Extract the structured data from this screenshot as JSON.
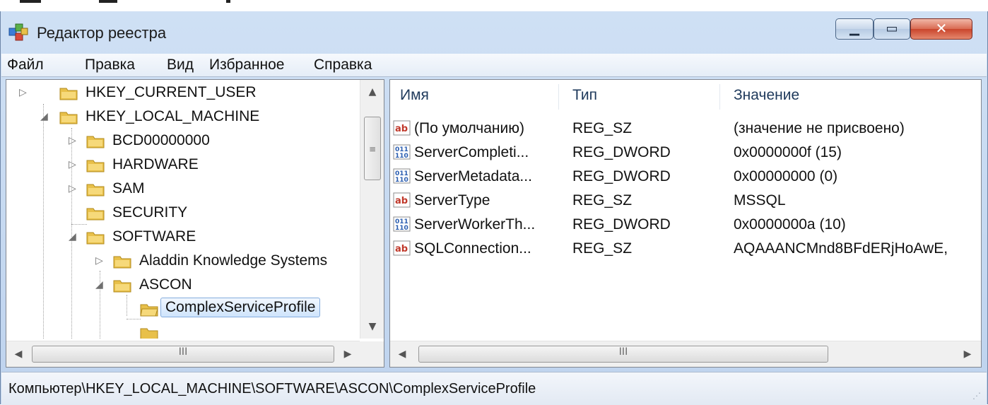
{
  "window": {
    "title": "Редактор реестра",
    "controls": {
      "minimize_icon": "minimize-icon",
      "maximize_icon": "maximize-icon",
      "close_icon": "close-icon"
    }
  },
  "menu": [
    "Файл",
    "Правка",
    "Вид",
    "Избранное",
    "Справка"
  ],
  "tree": {
    "items": [
      {
        "label": "HKEY_CURRENT_USER",
        "expanded": false,
        "level": 0
      },
      {
        "label": "HKEY_LOCAL_MACHINE",
        "expanded": true,
        "level": 0
      },
      {
        "label": "BCD00000000",
        "expanded": false,
        "level": 1
      },
      {
        "label": "HARDWARE",
        "expanded": false,
        "level": 1
      },
      {
        "label": "SAM",
        "expanded": false,
        "level": 1
      },
      {
        "label": "SECURITY",
        "expanded": null,
        "level": 1
      },
      {
        "label": "SOFTWARE",
        "expanded": true,
        "level": 1
      },
      {
        "label": "Aladdin Knowledge Systems",
        "expanded": false,
        "level": 2
      },
      {
        "label": "ASCON",
        "expanded": true,
        "level": 2
      },
      {
        "label": "ComplexServiceProfile",
        "expanded": null,
        "level": 3,
        "selected": true
      }
    ]
  },
  "list": {
    "columns": [
      "Имя",
      "Тип",
      "Значение"
    ],
    "rows": [
      {
        "icon": "string-value-icon",
        "name": "(По умолчанию)",
        "type": "REG_SZ",
        "value": "(значение не присвоено)"
      },
      {
        "icon": "binary-value-icon",
        "name": "ServerCompleti...",
        "type": "REG_DWORD",
        "value": "0x0000000f (15)"
      },
      {
        "icon": "binary-value-icon",
        "name": "ServerMetadata...",
        "type": "REG_DWORD",
        "value": "0x00000000 (0)"
      },
      {
        "icon": "string-value-icon",
        "name": "ServerType",
        "type": "REG_SZ",
        "value": "MSSQL"
      },
      {
        "icon": "binary-value-icon",
        "name": "ServerWorkerTh...",
        "type": "REG_DWORD",
        "value": "0x0000000a (10)"
      },
      {
        "icon": "string-value-icon",
        "name": "SQLConnection...",
        "type": "REG_SZ",
        "value": "AQAAANCMnd8BFdERjHoAwE,"
      }
    ]
  },
  "scrollbar_grip": "III",
  "statusbar": {
    "path": "Компьютер\\HKEY_LOCAL_MACHINE\\SOFTWARE\\ASCON\\ComplexServiceProfile"
  },
  "colors": {
    "folder": "#e8c04a",
    "selection": "#cfe4fc",
    "header_text": "#1e395b",
    "close_button": "#c9452c"
  }
}
